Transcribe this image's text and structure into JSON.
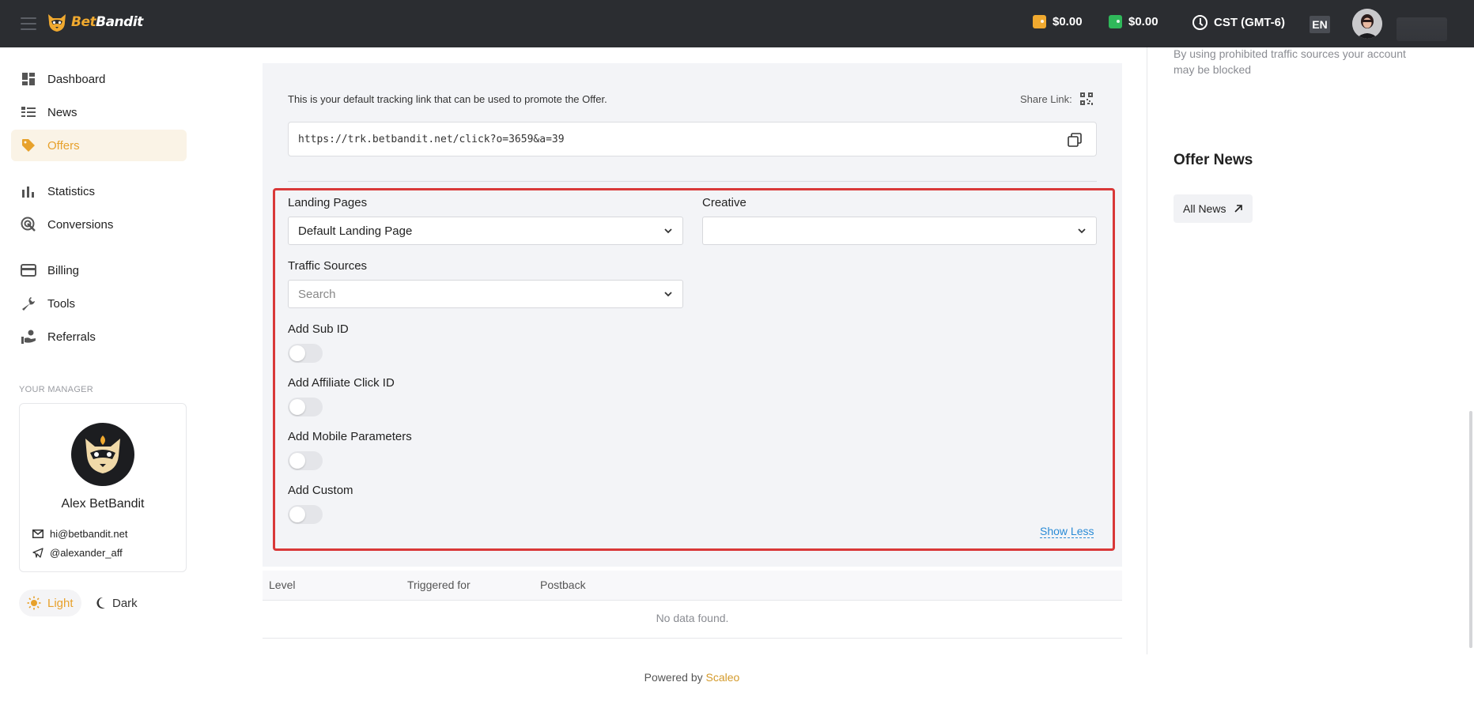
{
  "header": {
    "brand_bet": "Bet",
    "brand_bandit": "Bandit",
    "balance_1": "$0.00",
    "balance_2": "$0.00",
    "timezone": "CST (GMT-6)",
    "language": "EN",
    "colors": {
      "bar": "#2b2d31",
      "wallet_1": "#f0a92f",
      "wallet_2": "#2fb85a"
    }
  },
  "sidebar": {
    "items": [
      {
        "label": "Dashboard",
        "icon": "dashboard-icon"
      },
      {
        "label": "News",
        "icon": "news-icon"
      },
      {
        "label": "Offers",
        "icon": "tag-icon",
        "active": true
      },
      {
        "label": "Statistics",
        "icon": "bar-chart-icon"
      },
      {
        "label": "Conversions",
        "icon": "conversions-icon"
      },
      {
        "label": "Billing",
        "icon": "credit-card-icon"
      },
      {
        "label": "Tools",
        "icon": "wrench-icon"
      },
      {
        "label": "Referrals",
        "icon": "referrals-icon"
      }
    ],
    "manager_title": "YOUR MANAGER",
    "manager": {
      "name": "Alex BetBandit",
      "email": "hi@betbandit.net",
      "telegram": "@alexander_aff"
    },
    "theme": {
      "light": "Light",
      "dark": "Dark",
      "selected": "Light"
    },
    "accent_color": "#e7a12c"
  },
  "tracking": {
    "description": "This is your default tracking link that can be used to promote the Offer.",
    "share_label": "Share Link:",
    "url": "https://trk.betbandit.net/click?o=3659&a=39"
  },
  "form": {
    "landing_pages_label": "Landing Pages",
    "landing_pages_value": "Default Landing Page",
    "creative_label": "Creative",
    "creative_value": "",
    "traffic_sources_label": "Traffic Sources",
    "traffic_sources_placeholder": "Search",
    "toggles": [
      {
        "label": "Add Sub ID",
        "on": false
      },
      {
        "label": "Add Affiliate Click ID",
        "on": false
      },
      {
        "label": "Add Mobile Parameters",
        "on": false
      },
      {
        "label": "Add Custom",
        "on": false
      }
    ],
    "show_less": "Show Less"
  },
  "table": {
    "columns": [
      "Level",
      "Triggered for",
      "Postback"
    ],
    "empty": "No data found."
  },
  "footer": {
    "powered_by": "Powered by",
    "brand": "Scaleo"
  },
  "right": {
    "warning": "By using prohibited traffic sources your account may be blocked",
    "offer_news_title": "Offer News",
    "all_news": "All News"
  }
}
